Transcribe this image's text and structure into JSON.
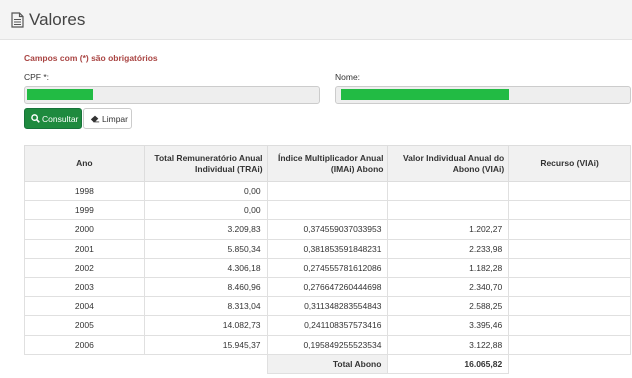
{
  "page": {
    "title": "Valores"
  },
  "form": {
    "required_note": "Campos com (*) são obrigatórios",
    "cpf_label": "CPF *:",
    "nome_label": "Nome:"
  },
  "buttons": {
    "consultar": "Consultar",
    "limpar": "Limpar"
  },
  "table": {
    "headers": {
      "ano": "Ano",
      "trai": "Total Remuneratório Anual Individual (TRAi)",
      "imai": "Índice Multiplicador Anual (IMAi) Abono",
      "viai": "Valor Individual Anual do Abono (VIAi)",
      "recurso": "Recurso (VIAi)"
    },
    "rows": [
      {
        "ano": "1998",
        "trai": "0,00",
        "imai": "",
        "viai": "",
        "recurso": ""
      },
      {
        "ano": "1999",
        "trai": "0,00",
        "imai": "",
        "viai": "",
        "recurso": ""
      },
      {
        "ano": "2000",
        "trai": "3.209,83",
        "imai": "0,374559037033953",
        "viai": "1.202,27",
        "recurso": ""
      },
      {
        "ano": "2001",
        "trai": "5.850,34",
        "imai": "0,381853591848231",
        "viai": "2.233,98",
        "recurso": ""
      },
      {
        "ano": "2002",
        "trai": "4.306,18",
        "imai": "0,274555781612086",
        "viai": "1.182,28",
        "recurso": ""
      },
      {
        "ano": "2003",
        "trai": "8.460,96",
        "imai": "0,276647260444698",
        "viai": "2.340,70",
        "recurso": ""
      },
      {
        "ano": "2004",
        "trai": "8.313,04",
        "imai": "0,311348283554843",
        "viai": "2.588,25",
        "recurso": ""
      },
      {
        "ano": "2005",
        "trai": "14.082,73",
        "imai": "0,241108357573416",
        "viai": "3.395,46",
        "recurso": ""
      },
      {
        "ano": "2006",
        "trai": "15.945,37",
        "imai": "0,195849255523534",
        "viai": "3.122,88",
        "recurso": ""
      }
    ],
    "total_label": "Total Abono",
    "total_value": "16.065,82"
  },
  "colors": {
    "accent": "#1e8a3e",
    "mask": "#22bb44",
    "required": "#a94442"
  },
  "icons": {
    "title": "document-icon",
    "consultar": "search-icon",
    "limpar": "eraser-icon"
  }
}
